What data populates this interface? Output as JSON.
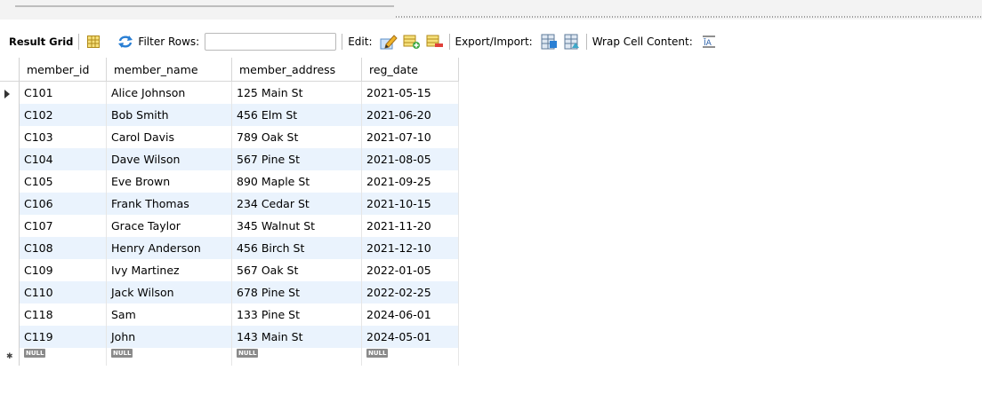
{
  "toolbar": {
    "result_grid": "Result Grid",
    "filter_rows": "Filter Rows:",
    "filter_value": "",
    "edit": "Edit:",
    "export_import": "Export/Import:",
    "wrap_cell": "Wrap Cell Content:"
  },
  "grid": {
    "columns": [
      "member_id",
      "member_name",
      "member_address",
      "reg_date"
    ],
    "rows": [
      [
        "C101",
        "Alice Johnson",
        "125 Main St",
        "2021-05-15"
      ],
      [
        "C102",
        "Bob Smith",
        "456 Elm St",
        "2021-06-20"
      ],
      [
        "C103",
        "Carol Davis",
        "789 Oak St",
        "2021-07-10"
      ],
      [
        "C104",
        "Dave Wilson",
        "567 Pine St",
        "2021-08-05"
      ],
      [
        "C105",
        "Eve Brown",
        "890 Maple St",
        "2021-09-25"
      ],
      [
        "C106",
        "Frank Thomas",
        "234 Cedar St",
        "2021-10-15"
      ],
      [
        "C107",
        "Grace Taylor",
        "345 Walnut St",
        "2021-11-20"
      ],
      [
        "C108",
        "Henry Anderson",
        "456 Birch St",
        "2021-12-10"
      ],
      [
        "C109",
        "Ivy Martinez",
        "567 Oak St",
        "2022-01-05"
      ],
      [
        "C110",
        "Jack Wilson",
        "678 Pine St",
        "2022-02-25"
      ],
      [
        "C118",
        "Sam",
        "133 Pine St",
        "2024-06-01"
      ],
      [
        "C119",
        "John",
        "143 Main St",
        "2024-05-01"
      ]
    ],
    "null_label": "NULL",
    "new_row_marker": "✱"
  },
  "colors": {
    "alt_row": "#eaf3fd",
    "null_badge": "#8a8a8a"
  },
  "icons": [
    "grid-layout-icon",
    "refresh-filter-icon",
    "edit-row-icon",
    "add-row-icon",
    "delete-row-icon",
    "export-icon",
    "import-icon",
    "wrap-text-icon"
  ]
}
